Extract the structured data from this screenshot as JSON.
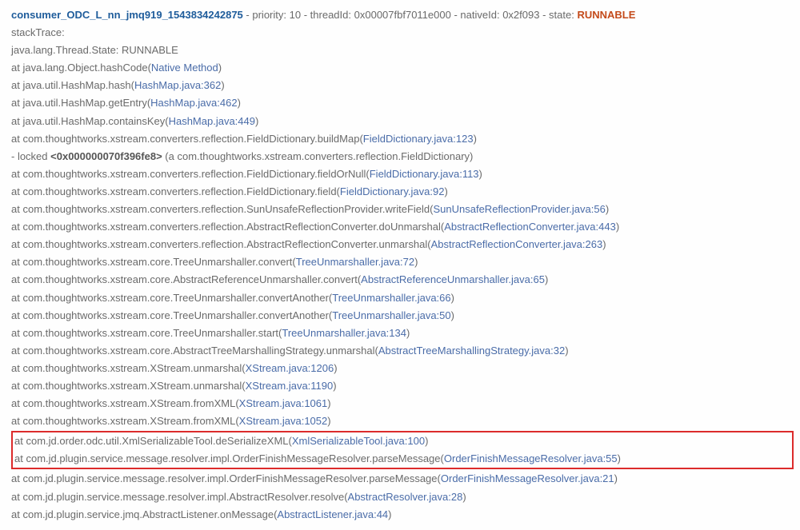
{
  "header": {
    "thread_name": "consumer_ODC_L_nn_jmq919_1543834242875",
    "sep1": " - ",
    "priority_lbl": "priority:",
    "priority_val": "10",
    "sep2": " - ",
    "thread_id_lbl": "threadId:",
    "thread_id_val": "0x00007fbf7011e000",
    "sep3": " - ",
    "native_id_lbl": "nativeId:",
    "native_id_val": "0x2f093",
    "sep4": " - ",
    "state_lbl": "state:",
    "state_val": "RUNNABLE"
  },
  "pre": {
    "stack_trace_lbl": "stackTrace:",
    "thread_state": "java.lang.Thread.State: RUNNABLE"
  },
  "frames": [
    {
      "method": "java.lang.Object.hashCode",
      "src": "Native Method"
    },
    {
      "method": "java.util.HashMap.hash",
      "src": "HashMap.java:362"
    },
    {
      "method": "java.util.HashMap.getEntry",
      "src": "HashMap.java:462"
    },
    {
      "method": "java.util.HashMap.containsKey",
      "src": "HashMap.java:449"
    },
    {
      "method": "com.thoughtworks.xstream.converters.reflection.FieldDictionary.buildMap",
      "src": "FieldDictionary.java:123"
    }
  ],
  "locked": {
    "prefix": "- locked ",
    "addr": "<0x000000070f396fe8>",
    "suffix": " (a com.thoughtworks.xstream.converters.reflection.FieldDictionary)"
  },
  "frames2": [
    {
      "method": "com.thoughtworks.xstream.converters.reflection.FieldDictionary.fieldOrNull",
      "src": "FieldDictionary.java:113"
    },
    {
      "method": "com.thoughtworks.xstream.converters.reflection.FieldDictionary.field",
      "src": "FieldDictionary.java:92"
    },
    {
      "method": "com.thoughtworks.xstream.converters.reflection.SunUnsafeReflectionProvider.writeField",
      "src": "SunUnsafeReflectionProvider.java:56"
    },
    {
      "method": "com.thoughtworks.xstream.converters.reflection.AbstractReflectionConverter.doUnmarshal",
      "src": "AbstractReflectionConverter.java:443"
    },
    {
      "method": "com.thoughtworks.xstream.converters.reflection.AbstractReflectionConverter.unmarshal",
      "src": "AbstractReflectionConverter.java:263"
    },
    {
      "method": "com.thoughtworks.xstream.core.TreeUnmarshaller.convert",
      "src": "TreeUnmarshaller.java:72"
    },
    {
      "method": "com.thoughtworks.xstream.core.AbstractReferenceUnmarshaller.convert",
      "src": "AbstractReferenceUnmarshaller.java:65"
    },
    {
      "method": "com.thoughtworks.xstream.core.TreeUnmarshaller.convertAnother",
      "src": "TreeUnmarshaller.java:66"
    },
    {
      "method": "com.thoughtworks.xstream.core.TreeUnmarshaller.convertAnother",
      "src": "TreeUnmarshaller.java:50"
    },
    {
      "method": "com.thoughtworks.xstream.core.TreeUnmarshaller.start",
      "src": "TreeUnmarshaller.java:134"
    },
    {
      "method": "com.thoughtworks.xstream.core.AbstractTreeMarshallingStrategy.unmarshal",
      "src": "AbstractTreeMarshallingStrategy.java:32"
    },
    {
      "method": "com.thoughtworks.xstream.XStream.unmarshal",
      "src": "XStream.java:1206"
    },
    {
      "method": "com.thoughtworks.xstream.XStream.unmarshal",
      "src": "XStream.java:1190"
    },
    {
      "method": "com.thoughtworks.xstream.XStream.fromXML",
      "src": "XStream.java:1061"
    },
    {
      "method": "com.thoughtworks.xstream.XStream.fromXML",
      "src": "XStream.java:1052"
    }
  ],
  "highlight": [
    {
      "method": "com.jd.order.odc.util.XmlSerializableTool.deSerializeXML",
      "src": "XmlSerializableTool.java:100"
    },
    {
      "method": "com.jd.plugin.service.message.resolver.impl.OrderFinishMessageResolver.parseMessage",
      "src": "OrderFinishMessageResolver.java:55"
    }
  ],
  "frames3": [
    {
      "method": "com.jd.plugin.service.message.resolver.impl.OrderFinishMessageResolver.parseMessage",
      "src": "OrderFinishMessageResolver.java:21"
    },
    {
      "method": "com.jd.plugin.service.message.resolver.impl.AbstractResolver.resolve",
      "src": "AbstractResolver.java:28"
    },
    {
      "method": "com.jd.plugin.service.jmq.AbstractListener.onMessage",
      "src": "AbstractListener.java:44"
    }
  ],
  "glue": {
    "at": "at ",
    "lp": "(",
    "rp": ")"
  }
}
